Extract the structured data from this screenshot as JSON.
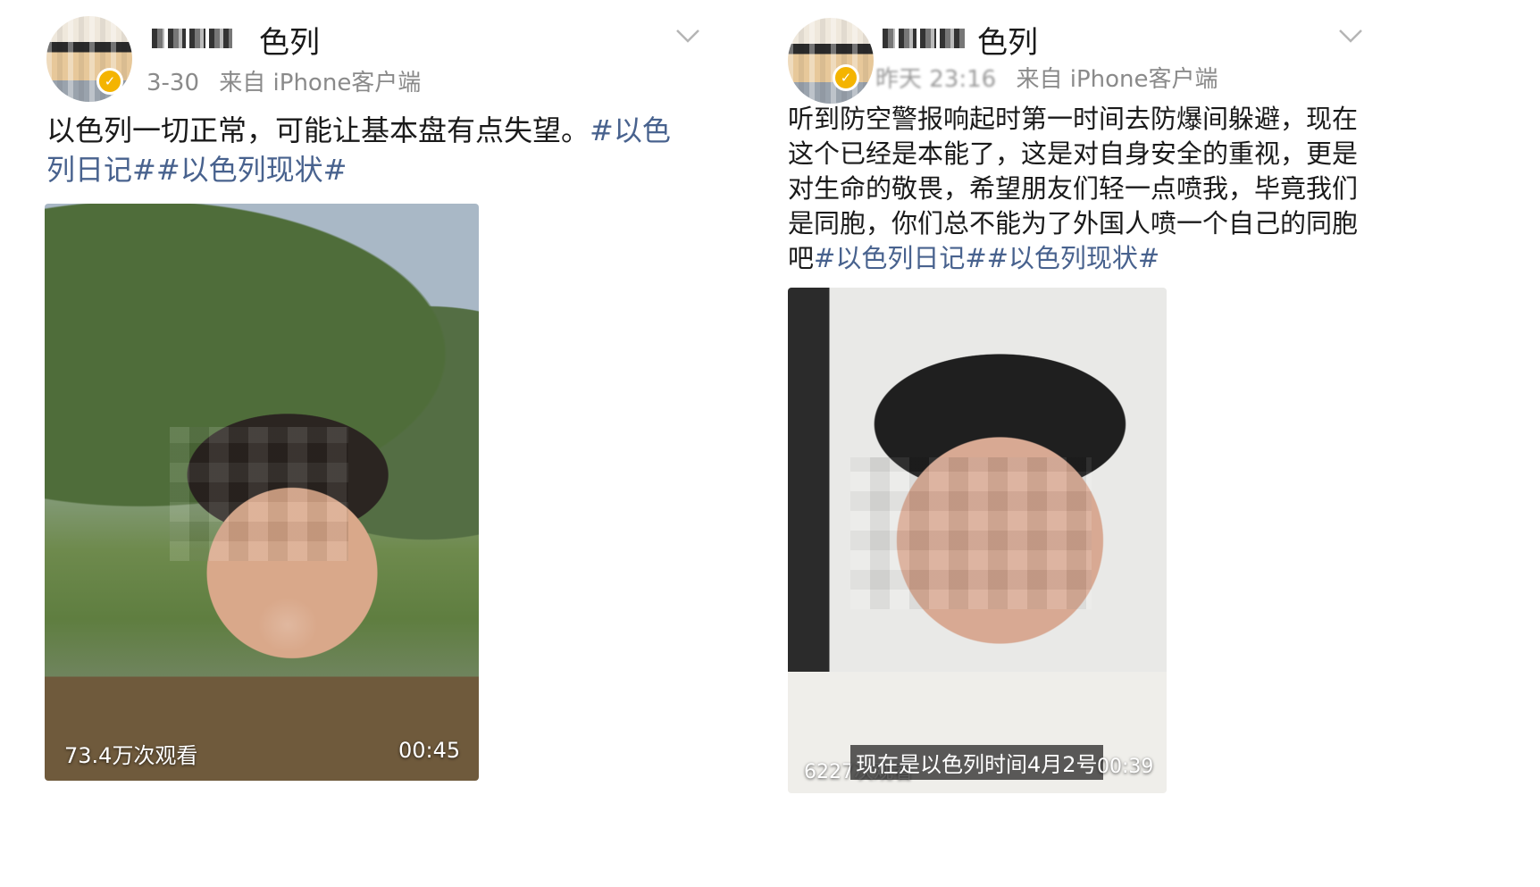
{
  "posts": [
    {
      "username_visible": "色列",
      "timestamp": "3-30",
      "source": "来自 iPhone客户端",
      "text": "以色列一切正常，可能让基本盘有点失望。",
      "hashtags": "#以色列日记##以色列现状#",
      "video": {
        "views": "73.4万次观看",
        "duration": "00:45"
      },
      "chevron_icon": "chevron-down-icon"
    },
    {
      "username_visible": "色列",
      "timestamp": "昨天 23:16",
      "source": "来自 iPhone客户端",
      "text": "听到防空警报响起时第一时间去防爆间躲避，现在这个已经是本能了，这是对自身安全的重视，更是对生命的敬畏，希望朋友们轻一点喷我，毕竟我们是同胞，你们总不能为了外国人喷一个自己的同胞吧",
      "hashtags": "#以色列日记##以色列现状#",
      "video": {
        "views": "6227次观看",
        "subtitle": "现在是以色列时间4月2号",
        "duration": "00:39"
      },
      "chevron_icon": "chevron-down-icon"
    }
  ],
  "colors": {
    "hashtag": "#48628e",
    "meta_gray": "#8a8a8a",
    "verified_badge": "#f4b400"
  }
}
